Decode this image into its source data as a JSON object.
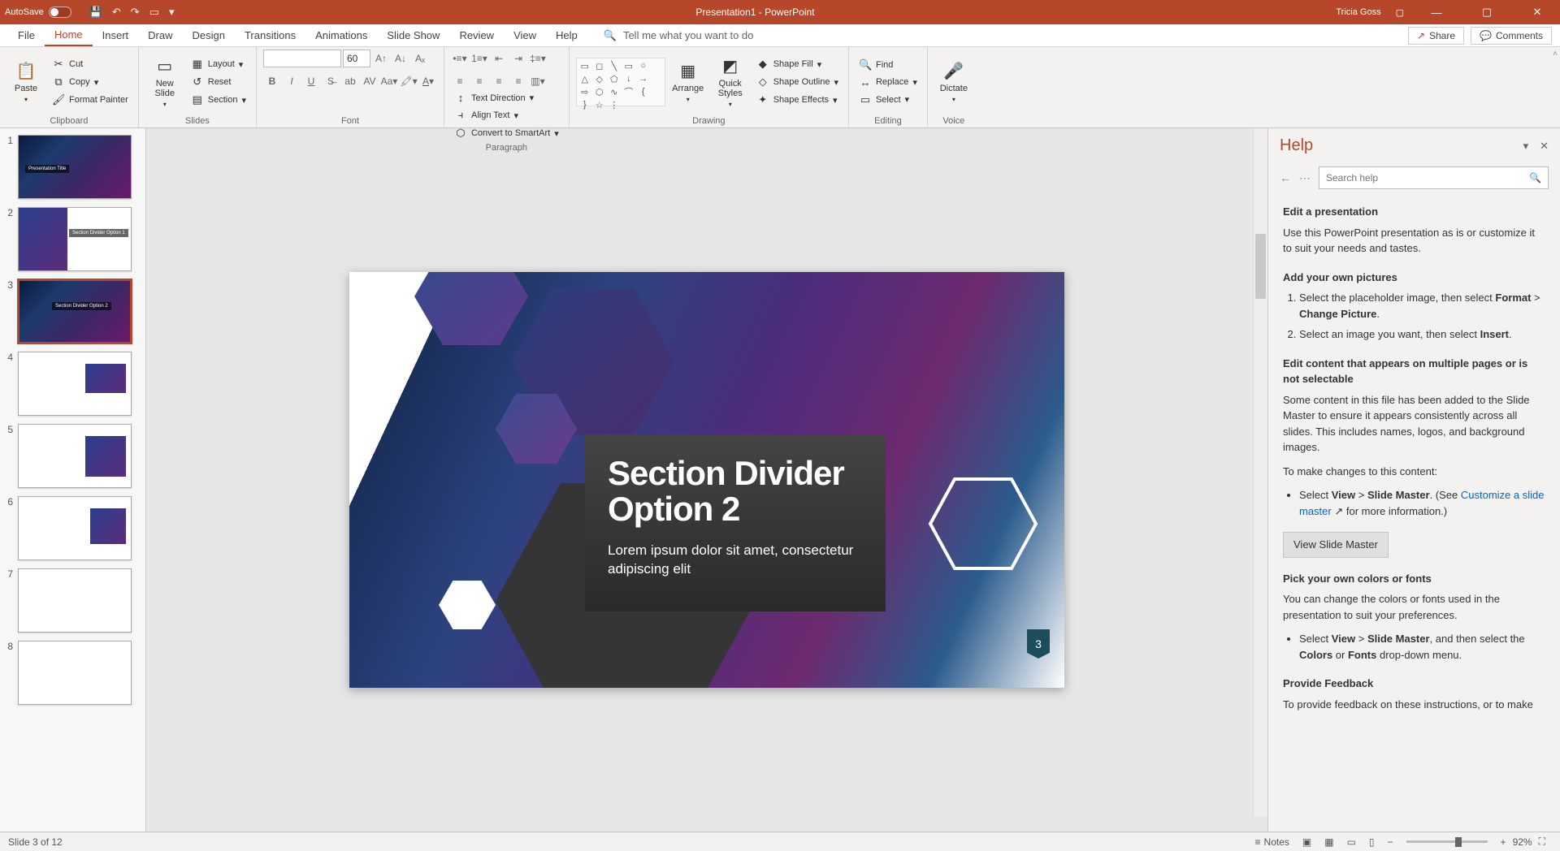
{
  "titlebar": {
    "autosave": "AutoSave",
    "title": "Presentation1 - PowerPoint",
    "user": "Tricia Goss"
  },
  "tabs": [
    "File",
    "Home",
    "Insert",
    "Draw",
    "Design",
    "Transitions",
    "Animations",
    "Slide Show",
    "Review",
    "View",
    "Help"
  ],
  "tellme": "Tell me what you want to do",
  "share": "Share",
  "comments": "Comments",
  "ribbon": {
    "clipboard": {
      "paste": "Paste",
      "cut": "Cut",
      "copy": "Copy",
      "fmt": "Format Painter",
      "label": "Clipboard"
    },
    "slides": {
      "new": "New\nSlide",
      "layout": "Layout",
      "reset": "Reset",
      "section": "Section",
      "label": "Slides"
    },
    "font": {
      "size": "60",
      "label": "Font"
    },
    "paragraph": {
      "textdir": "Text Direction",
      "align": "Align Text",
      "smartart": "Convert to SmartArt",
      "label": "Paragraph"
    },
    "drawing": {
      "arrange": "Arrange",
      "quick": "Quick\nStyles",
      "fill": "Shape Fill",
      "outline": "Shape Outline",
      "effects": "Shape Effects",
      "label": "Drawing"
    },
    "editing": {
      "find": "Find",
      "replace": "Replace",
      "select": "Select",
      "label": "Editing"
    },
    "voice": {
      "dictate": "Dictate",
      "label": "Voice"
    }
  },
  "thumbs": [
    {
      "n": 1,
      "label": "Presentation Title"
    },
    {
      "n": 2,
      "label": "Section Divider Option 1"
    },
    {
      "n": 3,
      "label": "Section Divider Option 2"
    },
    {
      "n": 4,
      "label": ""
    },
    {
      "n": 5,
      "label": ""
    },
    {
      "n": 6,
      "label": ""
    },
    {
      "n": 7,
      "label": ""
    },
    {
      "n": 8,
      "label": ""
    }
  ],
  "slide": {
    "title": "Section Divider Option 2",
    "body": "Lorem ipsum dolor sit amet, consectetur adipiscing elit",
    "number": "3"
  },
  "help": {
    "title": "Help",
    "search_placeholder": "Search help",
    "h1": "Edit a presentation",
    "p1": "Use this PowerPoint presentation as is or customize it to suit your needs and tastes.",
    "h2": "Add your own pictures",
    "ol1a": "Select the placeholder image, then select ",
    "ol1b": "Format",
    "ol1c": " > ",
    "ol1d": "Change Picture",
    "ol1e": ".",
    "ol2a": "Select an image you want, then select ",
    "ol2b": "Insert",
    "ol2c": ".",
    "h3": "Edit content that appears on multiple pages or is not selectable",
    "p3": "Some content in this file has been added to the Slide Master to ensure it appears consistently across all slides. This includes names, logos, and background images.",
    "p4": "To make changes to this content:",
    "li1a": "Select ",
    "li1b": "View",
    "li1c": " > ",
    "li1d": "Slide Master",
    "li1e": ". (See ",
    "li1f": "Customize a slide master",
    "li1g": " for more information.)",
    "btn": "View Slide Master",
    "h4": "Pick your own colors or fonts",
    "p5": "You can change the colors or fonts used in the presentation to suit your preferences.",
    "li2a": "Select ",
    "li2b": "View",
    "li2c": " > ",
    "li2d": "Slide Master",
    "li2e": ", and then select the ",
    "li2f": "Colors",
    "li2g": " or ",
    "li2h": "Fonts",
    "li2i": " drop-down menu.",
    "h5": "Provide Feedback",
    "p6": "To provide feedback on these instructions, or to make"
  },
  "status": {
    "slide": "Slide 3 of 12",
    "notes": "Notes",
    "zoom": "92%"
  }
}
